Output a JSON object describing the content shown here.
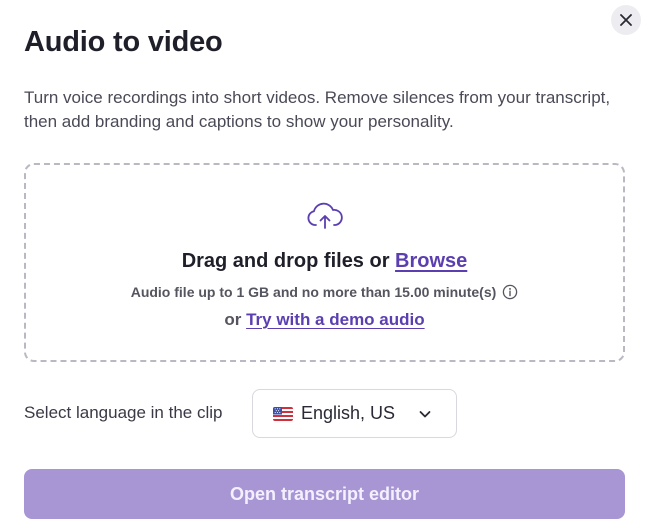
{
  "dialog": {
    "title": "Audio to video",
    "description": "Turn voice recordings into short videos. Remove silences from your transcript, then add branding and captions to show your personality.",
    "close_icon": "close-icon"
  },
  "dropzone": {
    "icon": "cloud-upload-icon",
    "drag_text": "Drag and drop files or ",
    "browse_link": "Browse",
    "limit_text": "Audio file up to 1 GB and no more than 15.00 minute(s)",
    "info_icon": "info-icon",
    "or_text": "or ",
    "demo_link": "Try with a demo audio"
  },
  "language": {
    "label": "Select language in the clip",
    "selected": "English, US",
    "flag_icon": "us-flag-icon",
    "chevron_icon": "chevron-down-icon"
  },
  "actions": {
    "primary_label": "Open transcript editor"
  },
  "colors": {
    "accent": "#5b3fb0",
    "primary_button": "#a895d3",
    "primary_text": "#f4f0ff",
    "border": "#b9b9c4"
  }
}
